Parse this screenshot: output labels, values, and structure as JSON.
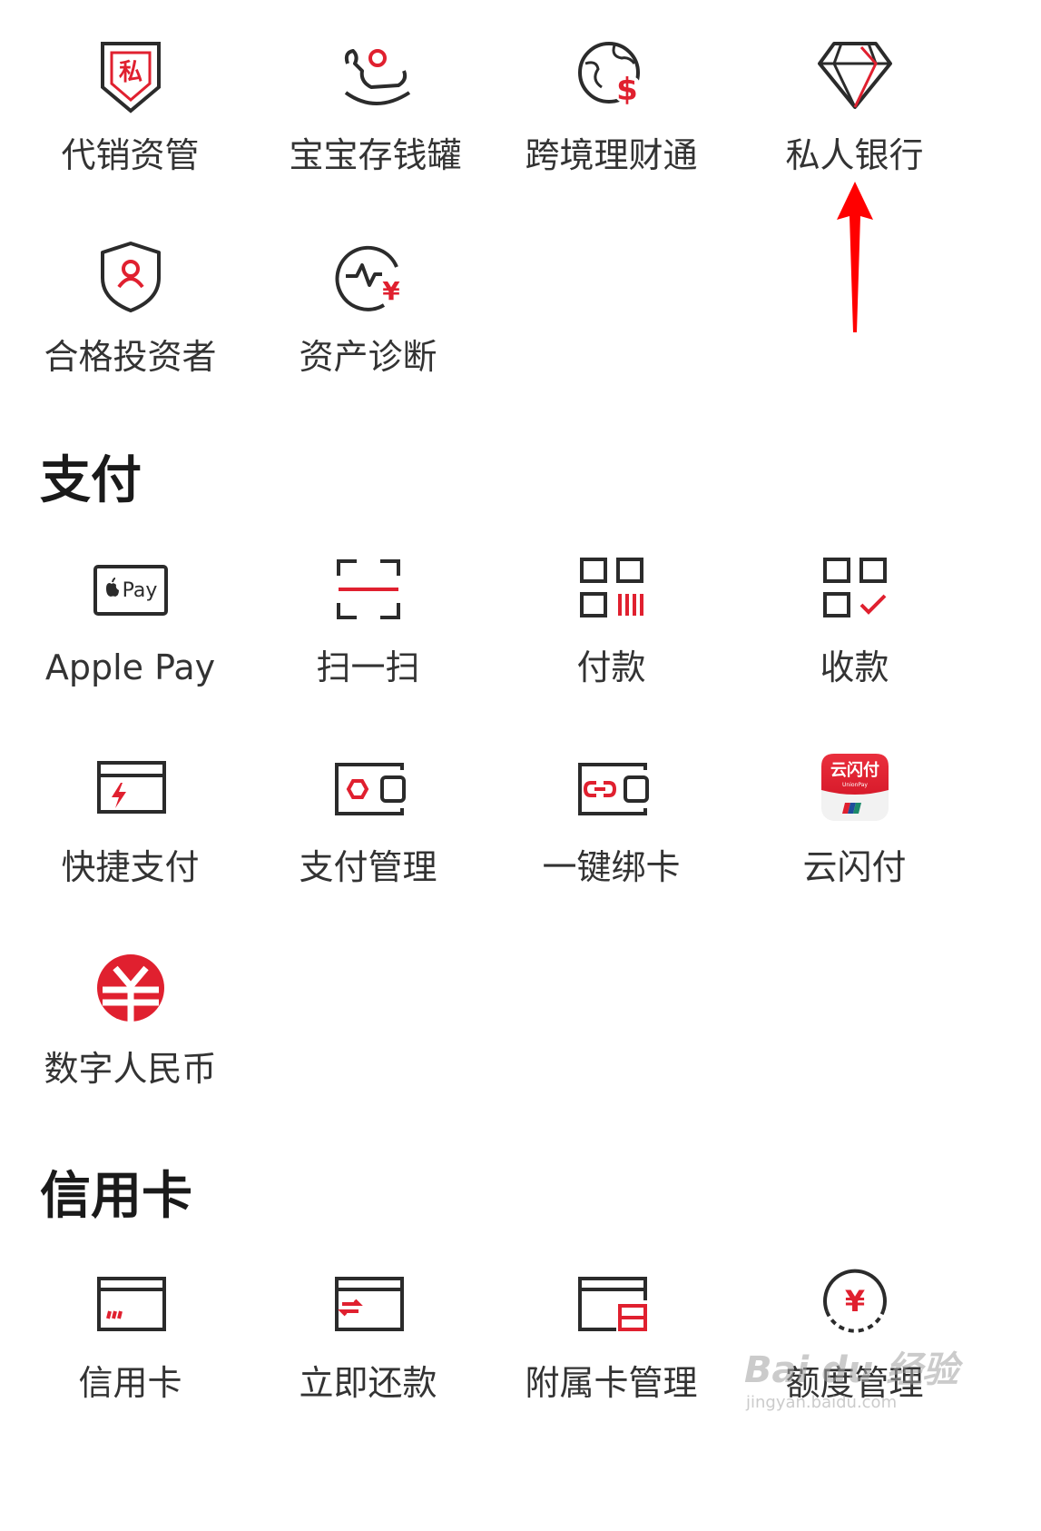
{
  "wealth": {
    "items": [
      {
        "label": "代销资管",
        "icon": "private-shield-icon"
      },
      {
        "label": "宝宝存钱罐",
        "icon": "rocking-horse-icon"
      },
      {
        "label": "跨境理财通",
        "icon": "globe-dollar-icon"
      },
      {
        "label": "私人银行",
        "icon": "diamond-icon"
      },
      {
        "label": "合格投资者",
        "icon": "user-shield-icon"
      },
      {
        "label": "资产诊断",
        "icon": "pulse-yen-icon"
      }
    ],
    "private_badge": "私"
  },
  "payment": {
    "title": "支付",
    "apple_pay_badge": "Pay",
    "items": [
      {
        "label": "Apple Pay",
        "icon": "apple-pay-icon"
      },
      {
        "label": "扫一扫",
        "icon": "scan-icon"
      },
      {
        "label": "付款",
        "icon": "pay-code-icon"
      },
      {
        "label": "收款",
        "icon": "receive-code-icon"
      },
      {
        "label": "快捷支付",
        "icon": "quick-pay-card-icon"
      },
      {
        "label": "支付管理",
        "icon": "wallet-hex-icon"
      },
      {
        "label": "一键绑卡",
        "icon": "wallet-link-icon"
      },
      {
        "label": "云闪付",
        "icon": "unionpay-quickpass-icon"
      },
      {
        "label": "数字人民币",
        "icon": "digital-rmb-icon"
      }
    ],
    "yunshanfu_logo": "云闪付",
    "yunshanfu_sub": "UnionPay"
  },
  "credit": {
    "title": "信用卡",
    "items": [
      {
        "label": "信用卡",
        "icon": "credit-card-icon"
      },
      {
        "label": "立即还款",
        "icon": "repay-card-icon"
      },
      {
        "label": "附属卡管理",
        "icon": "supplementary-card-icon"
      },
      {
        "label": "额度管理",
        "icon": "limit-yen-icon"
      }
    ]
  },
  "watermark": {
    "main": "Bai du 经验",
    "sub": "jingyan.baidu.com"
  },
  "colors": {
    "accent": "#e0202f",
    "icon_dark": "#2b2b2b",
    "annotation": "#ff0000"
  }
}
